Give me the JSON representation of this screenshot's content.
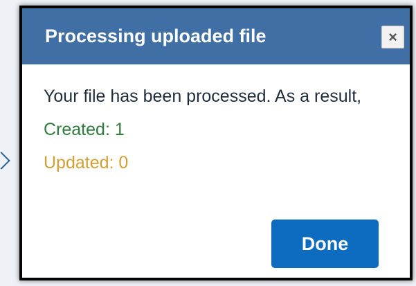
{
  "dialog": {
    "title": "Processing uploaded file",
    "close_icon": "close-icon",
    "close_symbol": "×",
    "message": "Your file has been processed. As a result,",
    "created_text": "Created: 1",
    "updated_text": "Updated: 0",
    "done_label": "Done"
  },
  "colors": {
    "title_bar": "#3f6fa4",
    "done_button": "#0d6cbf",
    "created_text": "#2f7b3e",
    "updated_text": "#d39f32"
  }
}
